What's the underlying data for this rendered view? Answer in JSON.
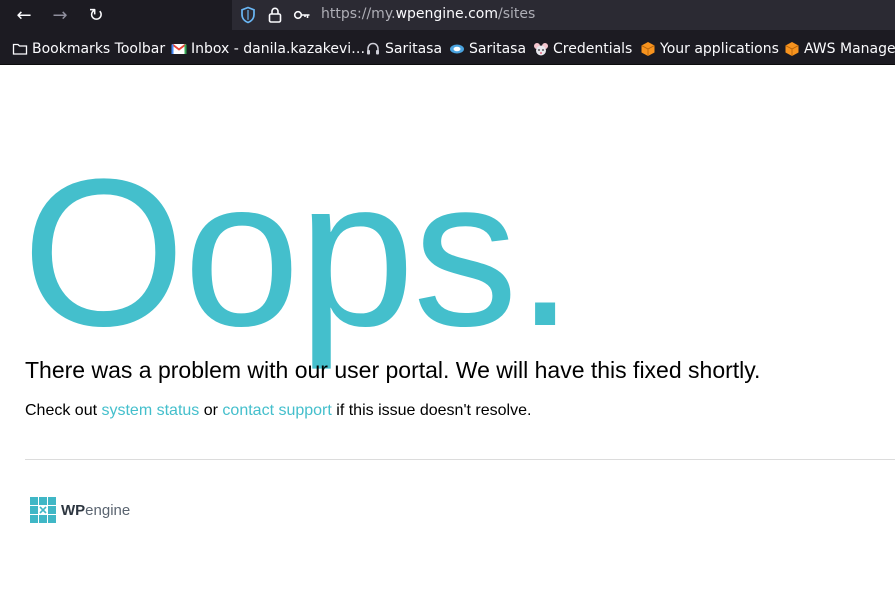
{
  "browser": {
    "url_prefix": "https://my.",
    "url_domain": "wpengine.com",
    "url_path": "/sites"
  },
  "bookmarks": [
    {
      "label": "Bookmarks Toolbar",
      "icon": "folder-icon"
    },
    {
      "label": "Inbox - danila.kazakevi…",
      "icon": "gmail-icon"
    },
    {
      "label": "Saritasa",
      "icon": "headset-icon"
    },
    {
      "label": "Saritasa",
      "icon": "saritasa-logo-icon"
    },
    {
      "label": "Credentials",
      "icon": "mouse-icon"
    },
    {
      "label": "Your applications",
      "icon": "aws-cube-icon"
    },
    {
      "label": "AWS Manager",
      "icon": "aws-cube-icon"
    }
  ],
  "page": {
    "title": "Oops.",
    "headline": "There was a problem with our user portal. We will have this fixed shortly.",
    "sub_prefix": "Check out ",
    "status_link": "system status",
    "sub_middle": " or ",
    "support_link": "contact support",
    "sub_suffix": " if this issue doesn't resolve.",
    "logo_wp": "WP",
    "logo_engine": "engine"
  },
  "colors": {
    "accent": "#44bfcc",
    "chrome_bg": "#1c1b22"
  }
}
